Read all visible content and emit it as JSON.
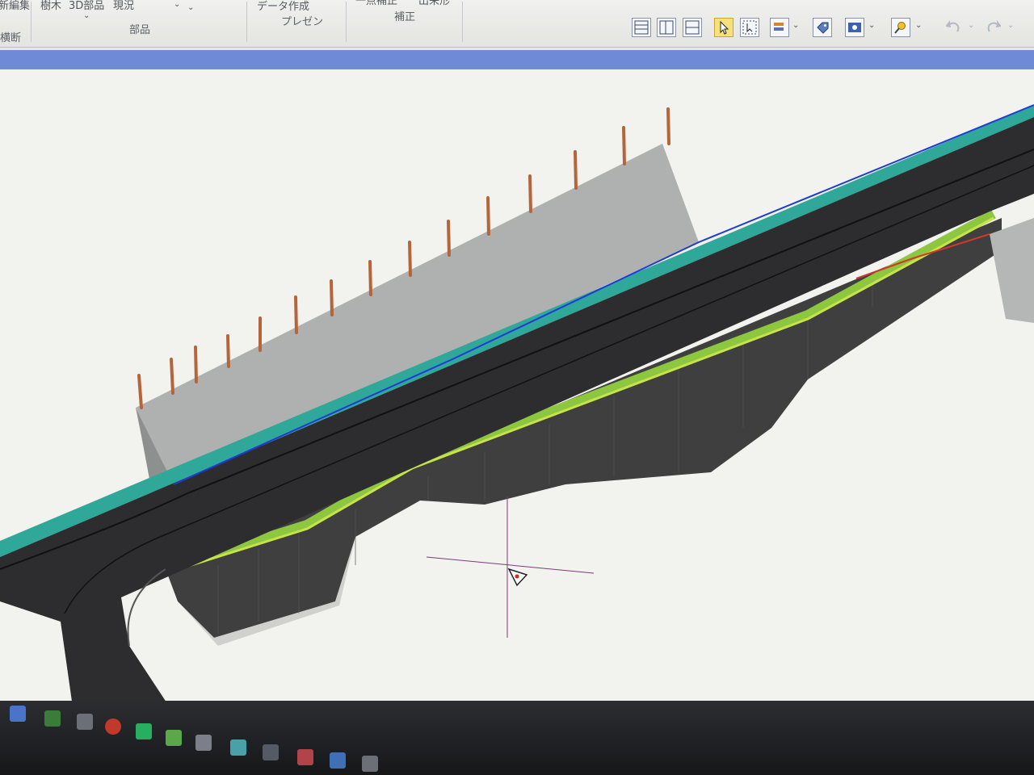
{
  "ribbon": {
    "tab_labels": [
      "新編集",
      "樹木",
      "3D部品",
      "現況"
    ],
    "group_label_left": "横断",
    "group_label_parts": "部品",
    "presentation": {
      "button_label": "データ作成",
      "group_label": "プレゼン"
    },
    "correction": {
      "button_label": "一点補正",
      "button_label_2": "出来形",
      "group_label": "補正"
    },
    "quick_tools": [
      {
        "name": "layout-horizontal-icon"
      },
      {
        "name": "layout-vertical-icon"
      },
      {
        "name": "layout-split-icon"
      },
      {
        "name": "select-cursor-icon",
        "active": true
      },
      {
        "name": "zoom-select-icon"
      },
      {
        "name": "layer-order-icon"
      },
      {
        "name": "tag-icon"
      },
      {
        "name": "view-eye-icon"
      },
      {
        "name": "search-tool-icon"
      },
      {
        "name": "undo-icon"
      },
      {
        "name": "redo-icon"
      }
    ]
  },
  "viewport": {
    "background": "#f2f2ee",
    "road_color": "#2d2d2f",
    "cut_slope_color": "#a7a9a8",
    "berm_color": "#8dc63f",
    "edge_color": "#2fa89a",
    "pole_color": "#b5653b"
  },
  "taskbar": {
    "background": "#1d1e20"
  }
}
